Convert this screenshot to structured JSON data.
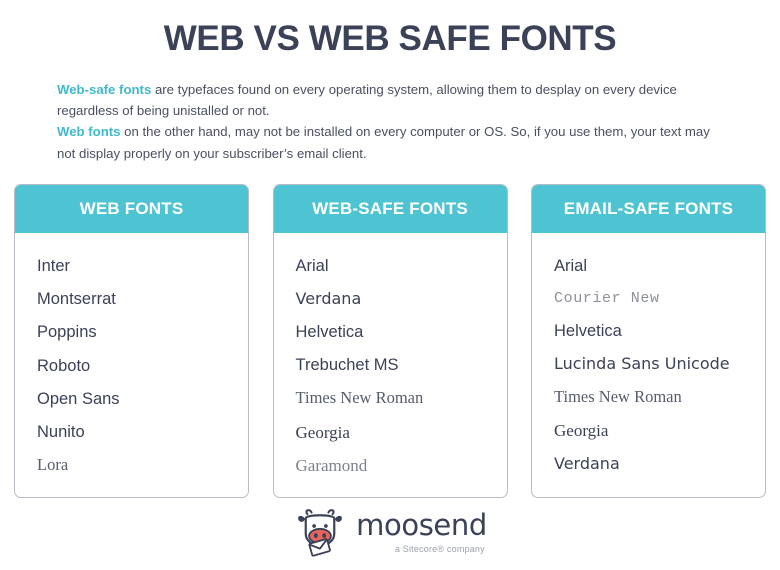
{
  "page": {
    "title": "WEB VS WEB SAFE FONTS",
    "background_color": "#ffffff",
    "title_color": "#3b4257",
    "accent_color": "#3fb9cd",
    "header_color": "#4ec3d2"
  },
  "intro": {
    "paragraph1": {
      "accent": "Web-safe fonts",
      "rest": " are typefaces found on every operating system, allowing them to desplay on every device regardless of being unistalled or not."
    },
    "paragraph2": {
      "accent": "Web fonts",
      "rest": " on the other hand, may not be installed on every computer or OS. So, if you use them, your text may not display properly on your subscriber’s email client."
    }
  },
  "cards": [
    {
      "header": "WEB FONTS",
      "items": [
        {
          "label": "Inter",
          "style": "f-sans"
        },
        {
          "label": "Montserrat",
          "style": "f-sans"
        },
        {
          "label": "Poppins",
          "style": "f-sans"
        },
        {
          "label": "Roboto",
          "style": "f-sans"
        },
        {
          "label": "Open Sans",
          "style": "f-sans"
        },
        {
          "label": "Nunito",
          "style": "f-sans"
        },
        {
          "label": "Lora",
          "style": "f-serif-gray"
        }
      ]
    },
    {
      "header": "WEB-SAFE FONTS",
      "items": [
        {
          "label": "Arial",
          "style": "f-sans"
        },
        {
          "label": "Verdana",
          "style": "f-sans-wide"
        },
        {
          "label": "Helvetica",
          "style": "f-sans"
        },
        {
          "label": "Trebuchet MS",
          "style": "f-sans-bold"
        },
        {
          "label": "Times New Roman",
          "style": "f-serif-gray"
        },
        {
          "label": "Georgia",
          "style": "f-serif"
        },
        {
          "label": "Garamond",
          "style": "f-serif-light"
        }
      ]
    },
    {
      "header": "EMAIL-SAFE FONTS",
      "items": [
        {
          "label": "Arial",
          "style": "f-sans"
        },
        {
          "label": "Courier New",
          "style": "f-mono"
        },
        {
          "label": "Helvetica",
          "style": "f-sans"
        },
        {
          "label": "Lucinda Sans Unicode",
          "style": "f-sans-wide"
        },
        {
          "label": "Times New Roman",
          "style": "f-serif-gray"
        },
        {
          "label": "Georgia",
          "style": "f-serif"
        },
        {
          "label": "Verdana",
          "style": "f-sans-wide"
        }
      ]
    }
  ],
  "footer": {
    "logo_icon": "moosend-cow-icon",
    "brand": "moosend",
    "tagline": "a Sitecore® company",
    "brand_color": "#3b4257",
    "snout_color": "#e8645c"
  }
}
